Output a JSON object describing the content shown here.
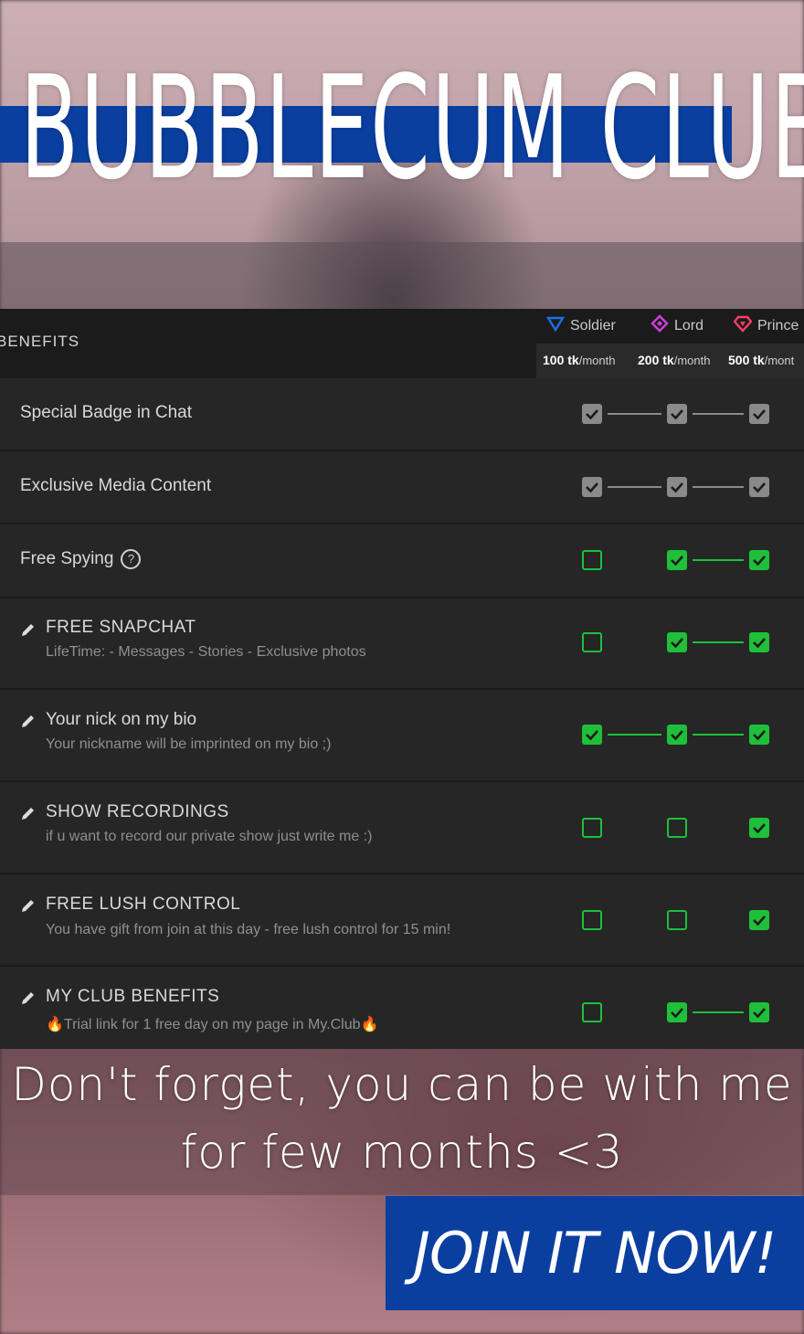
{
  "banner": {
    "title": "BUBBLECUM CLUB"
  },
  "table": {
    "header_label": "BENEFITS",
    "tiers": [
      {
        "name": "Soldier",
        "price": "100 tk",
        "unit": "/month",
        "icon": "soldier-triangle-icon",
        "color": "#1e6fe6"
      },
      {
        "name": "Lord",
        "price": "200 tk",
        "unit": "/month",
        "icon": "lord-diamond-icon",
        "color": "#d23ee0"
      },
      {
        "name": "Prince",
        "price": "500 tk",
        "unit": "/mont",
        "icon": "prince-gem-icon",
        "color": "#ff3d66"
      }
    ],
    "rows": [
      {
        "title": "Special Badge in Chat",
        "subtitle": "",
        "editable": false,
        "checks": [
          "gray",
          "gray",
          "gray"
        ]
      },
      {
        "title": "Exclusive Media Content",
        "subtitle": "",
        "editable": false,
        "checks": [
          "gray",
          "gray",
          "gray"
        ]
      },
      {
        "title": "Free Spying",
        "subtitle": "",
        "editable": false,
        "help": true,
        "checks": [
          "empty",
          "green",
          "green"
        ]
      },
      {
        "title": "FREE SNAPCHAT",
        "subtitle": "LifeTime: - Messages - Stories - Exclusive photos",
        "editable": true,
        "checks": [
          "empty",
          "green",
          "green"
        ]
      },
      {
        "title": "Your nick on my bio",
        "subtitle": "Your nickname will be imprinted on my bio ;)",
        "editable": true,
        "checks": [
          "green",
          "green",
          "green"
        ]
      },
      {
        "title": "SHOW RECORDINGS",
        "subtitle": "if u want to record our private show just write me :)",
        "editable": true,
        "checks": [
          "empty",
          "empty",
          "green"
        ]
      },
      {
        "title": "FREE LUSH CONTROL",
        "subtitle": "You have gift from join at this day - free lush control for 15 min!",
        "editable": true,
        "checks": [
          "empty",
          "empty",
          "green"
        ]
      },
      {
        "title": "MY CLUB BENEFITS",
        "subtitle": "🔥Trial link for 1 free day on my page in My.Club🔥",
        "editable": true,
        "checks": [
          "empty",
          "green",
          "green"
        ]
      }
    ]
  },
  "slogan": {
    "line1": "Don't forget, you can be with me",
    "line2": "for few months <3"
  },
  "cta": {
    "label": "JOIN IT NOW!"
  }
}
